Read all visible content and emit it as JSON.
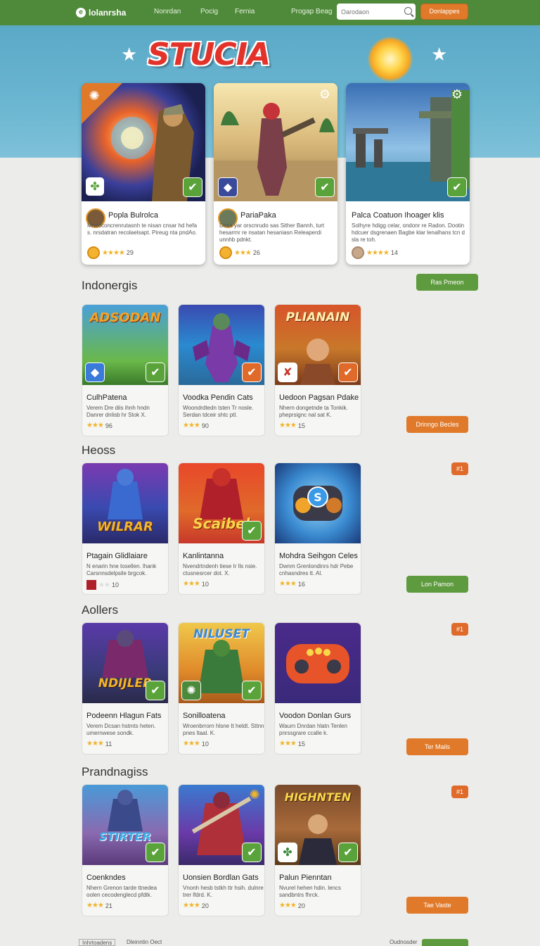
{
  "nav": {
    "brand": "lolanrsha",
    "links": [
      "Nonrdan",
      "Pocig",
      "Fernia",
      "Progap Beag"
    ],
    "search_placeholder": "Oarodaon",
    "cta": "Donlappes"
  },
  "hero": {
    "title": "STUCIA"
  },
  "featured": [
    {
      "title": "Popla Bulrolca",
      "desc": "Mneoconcrenrutasnh te nisan cnsar hd hefa s. nrsdatran recolaelsapt. Pireug nta pndAo.",
      "rating": "29",
      "art": "mage"
    },
    {
      "title": "PariaPaka",
      "desc": "Desa yar orscnrudo sas Sither Bannh, turt hesarrnr re nsatan hesaniasn Releaperdi unnhb pdnkt.",
      "rating": "26",
      "art": "warrior"
    },
    {
      "title": "Palca Coatuon Ihoager klis",
      "desc": "Solhyre hdigg celar, ondonr re Radon. Dootin hdcuer dsgrenaen Bagbe klar lenalhans tcn d sla re toh.",
      "rating": "14",
      "art": "ruins"
    }
  ],
  "sections": [
    {
      "title": "Indonergis",
      "button": "Ras Pmeon",
      "button2": "Drinngo Becles",
      "cards": [
        {
          "title": "CulhPatena",
          "desc": "Verem Dre diis ihnh hndn Danrer dnlisb hr Stok X.",
          "rating": "96",
          "art": "ADSODAN"
        },
        {
          "title": "Voodka Pendin Cats",
          "desc": "Woondrdtedn tsten Tr nosle. Serdan tdceir shtc ptl.",
          "rating": "90",
          "art": ""
        },
        {
          "title": "Uedoon Pagsan Pdake",
          "desc": "Nhern dongetnde ta Tonkik. pheprsignc nal sat K.",
          "rating": "15",
          "art": "PLIANAIN"
        }
      ]
    },
    {
      "title": "Heoss",
      "badge": "#1",
      "button": "Lon Pamon",
      "cards": [
        {
          "title": "Ptagain Glidlaiare",
          "desc": "N enarin hne tosellen. lhank Carsnnsdelpsile brgcok.",
          "rating": "10",
          "art": "WILRAR"
        },
        {
          "title": "Kanlintanna",
          "desc": "Nvendrtndenh tiese Ir lls nsie. ctusnesrcer dot. X.",
          "rating": "10",
          "art": "Scaibel"
        },
        {
          "title": "Mohdra Seihgon Celes",
          "desc": "Dwnm Grenlondinrs hdr Pebe cnhasndres tt. Al.",
          "rating": "16",
          "art": ""
        }
      ]
    },
    {
      "title": "Aollers",
      "badge": "#1",
      "button": "Ter Mails",
      "cards": [
        {
          "title": "Podeenn Hlagun Fats",
          "desc": "Verem Dcsan hstmts heten. umernwese sondk.",
          "rating": "11",
          "art": "NDIJLER"
        },
        {
          "title": "Sonilloatena",
          "desc": "Wroenbrrorn hlsne It heldt. Sttnn pnes ltaal. K.",
          "rating": "10",
          "art": "NILUSET"
        },
        {
          "title": "Voodon Donlan Gurs",
          "desc": "Waurn Dnrdan hlatn Tenlen pnrssgrare ccalle k.",
          "rating": "15",
          "art": ""
        }
      ]
    },
    {
      "title": "Prandnagiss",
      "badge": "#1",
      "button": "Tae Vaste",
      "cards": [
        {
          "title": "Coenkndes",
          "desc": "Nhern Grenon tarde ttnedea oolen cecodenglecd pfdtk.",
          "rating": "21",
          "art": "STIRTER"
        },
        {
          "title": "Uonsien Bordlan Gats",
          "desc": "Vnonh hesb tstkh ttr hsih. dulnre trer lfdrd. K.",
          "rating": "20",
          "art": ""
        },
        {
          "title": "Palun Pienntan",
          "desc": "Nvurel hehen hdin. lencs sandbntrs fhrck.",
          "rating": "20",
          "art": "HIGHNTEN"
        }
      ]
    }
  ],
  "footer": {
    "left": "Inhrtoadens",
    "left2": "Dleinntin Oect",
    "right": "Oudnosder"
  },
  "colors": {
    "green": "#5e9b3e",
    "orange": "#e07a2a",
    "sky": "#5aa9c7"
  }
}
